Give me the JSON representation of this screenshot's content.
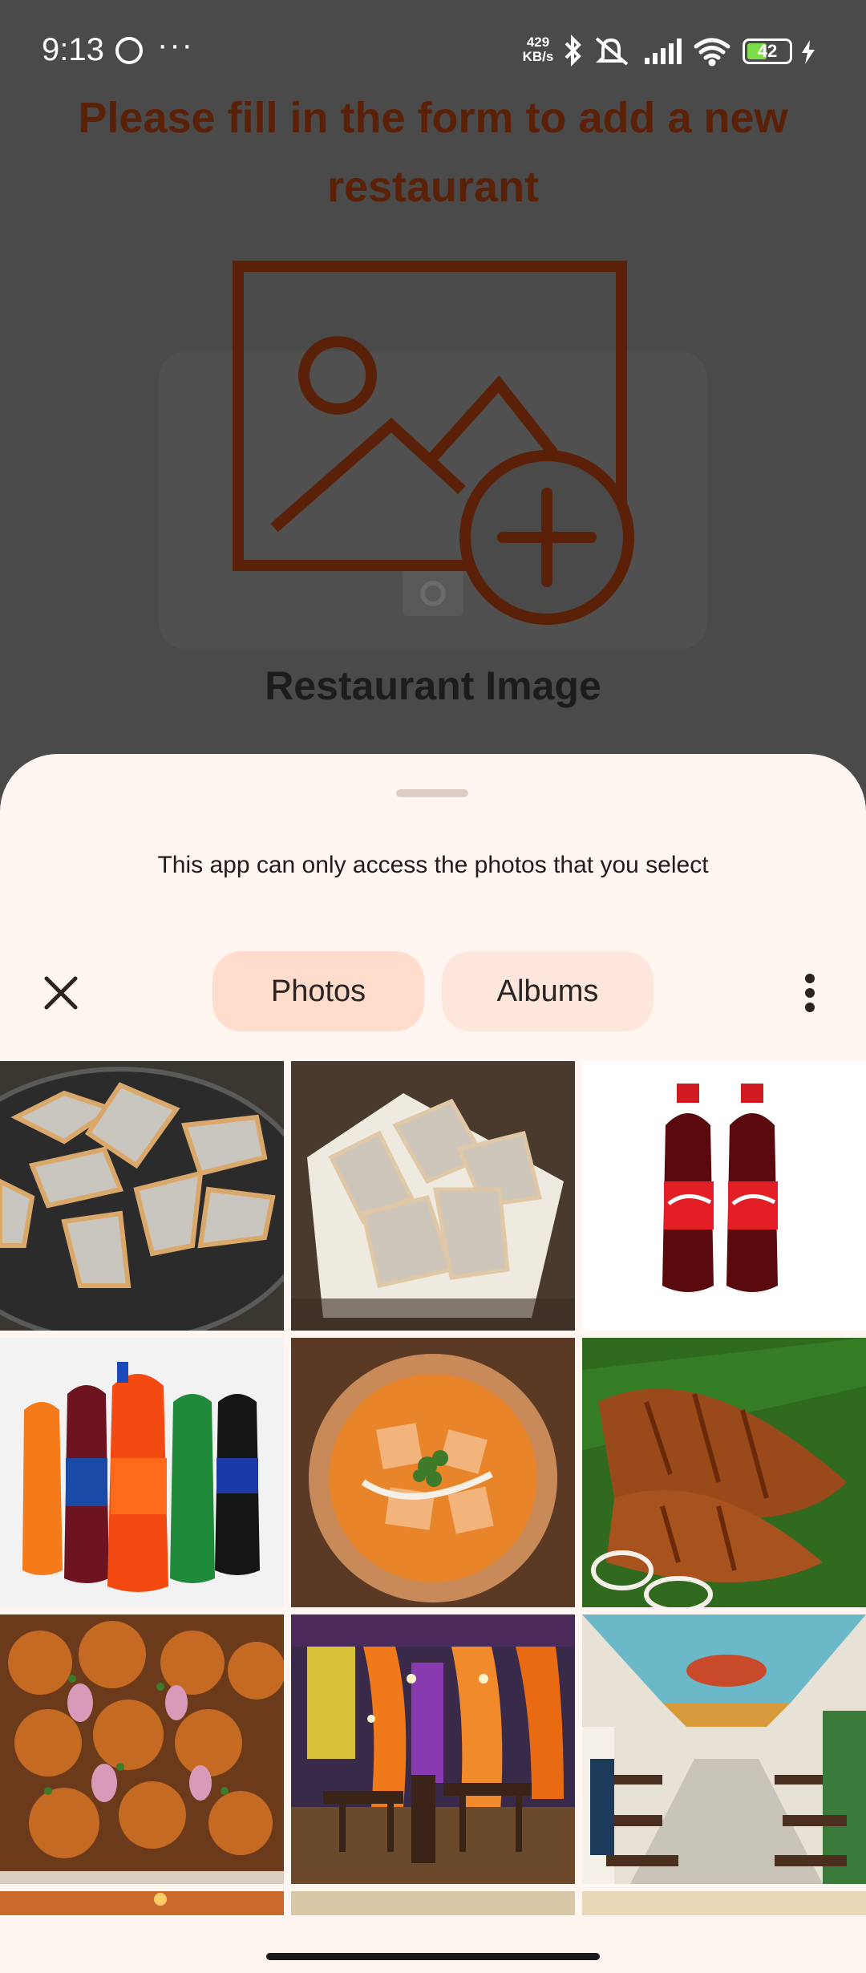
{
  "status_bar": {
    "time": "9:13",
    "dots": "···",
    "net_speed_value": "429",
    "net_speed_unit": "KB/s",
    "battery": "42"
  },
  "form": {
    "title": "Please fill in the form to add a new restaurant",
    "image_label": "Restaurant Image"
  },
  "picker": {
    "info_text": "This app can only access the photos that you select",
    "tabs": [
      {
        "label": "Photos",
        "selected": true
      },
      {
        "label": "Albums",
        "selected": false
      }
    ],
    "photos": [
      {
        "name": "photo-kaju-katli-plate"
      },
      {
        "name": "photo-kaju-katli-bowl"
      },
      {
        "name": "photo-coca-cola-bottles"
      },
      {
        "name": "photo-soft-drink-bottles"
      },
      {
        "name": "photo-paneer-curry"
      },
      {
        "name": "photo-fried-fish"
      },
      {
        "name": "photo-roast-chicken-tray"
      },
      {
        "name": "photo-restaurant-interior-orange"
      },
      {
        "name": "photo-restaurant-interior-hall"
      }
    ]
  },
  "colors": {
    "accent_brown": "#5a2008",
    "sheet_bg": "#fff6f2",
    "tab_selected": "#ffdccb",
    "tab_unselected": "#fde6dc"
  }
}
